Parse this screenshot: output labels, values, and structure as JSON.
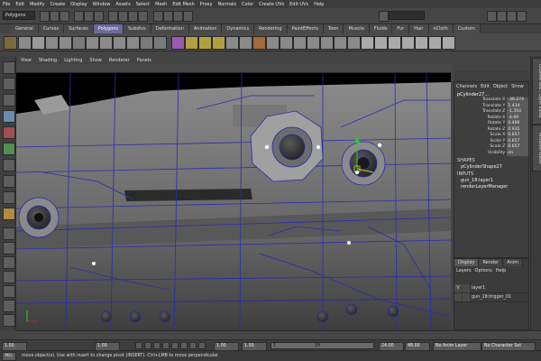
{
  "menus": [
    "File",
    "Edit",
    "Modify",
    "Create",
    "Display",
    "Window",
    "Assets",
    "Select",
    "Mesh",
    "Edit Mesh",
    "Proxy",
    "Normals",
    "Color",
    "Create UVs",
    "Edit UVs",
    "Help"
  ],
  "status_line": {
    "mode": "Polygons"
  },
  "shelf_tabs": [
    "General",
    "Curves",
    "Surfaces",
    "Polygons",
    "Subdivs",
    "Deformation",
    "Animation",
    "Dynamics",
    "Rendering",
    "PaintEffects",
    "Toon",
    "Muscle",
    "Fluids",
    "Fur",
    "Hair",
    "nCloth",
    "Custom"
  ],
  "shelf_active": "Polygons",
  "panel_menu": [
    "View",
    "Shading",
    "Lighting",
    "Show",
    "Renderer",
    "Panels"
  ],
  "channel_box": {
    "tabs": "Channel Box / Layer Editor",
    "menu": [
      "Channels",
      "Edit",
      "Object",
      "Show"
    ],
    "object": "pCylinder27...",
    "attributes": [
      {
        "name": "Translate X",
        "value": "-39.274"
      },
      {
        "name": "Translate Y",
        "value": "1.434"
      },
      {
        "name": "Translate Z",
        "value": "-1.354"
      },
      {
        "name": "Rotate X",
        "value": "-4.69"
      },
      {
        "name": "Rotate Y",
        "value": "0.406"
      },
      {
        "name": "Rotate Z",
        "value": "0.935"
      },
      {
        "name": "Scale X",
        "value": "0.657"
      },
      {
        "name": "Scale Y",
        "value": "0.657"
      },
      {
        "name": "Scale Z",
        "value": "0.657"
      },
      {
        "name": "Visibility",
        "value": "on"
      }
    ],
    "shapes_label": "SHAPES",
    "shape": "pCylinderShape27",
    "inputs_label": "INPUTS",
    "inputs": [
      "gun_18:layer1",
      "renderLayerManager"
    ]
  },
  "side_tabs": [
    "Channel Box / Layer Editor",
    "Attribute Editor"
  ],
  "layer_editor": {
    "tabs": [
      "Display",
      "Render",
      "Anim"
    ],
    "active_tab": "Display",
    "menu": [
      "Layers",
      "Options",
      "Help"
    ],
    "layers": [
      {
        "visible": "V",
        "name": "layer1"
      },
      {
        "visible": "",
        "name": "gun_18:trigger_01"
      }
    ]
  },
  "timeline": {
    "start": "1.00",
    "current": "1.00",
    "range_start": "1.00",
    "range_field": "1",
    "range_end_marker": "24",
    "end": "24.00",
    "anim_end": "48.00",
    "anim_layer": "No Anim Layer",
    "char_set": "No Character Set",
    "field_1": "1.00"
  },
  "help_line": {
    "mel": "MEL",
    "text": "move object(s). Use with insert to change pivot (INSERT).  Ctrl+LMB to move perpendicular"
  }
}
